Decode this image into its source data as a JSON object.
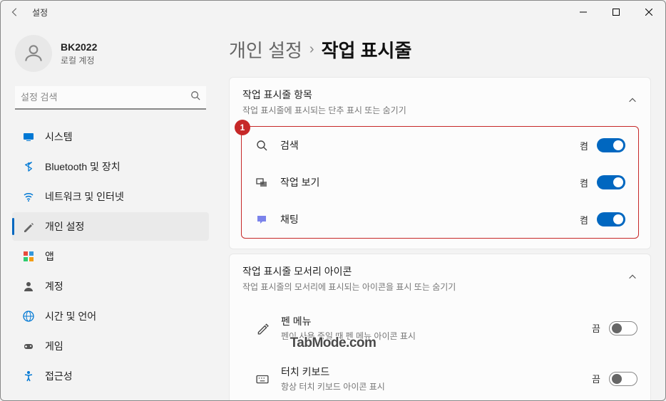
{
  "titlebar": {
    "app_title": "설정"
  },
  "profile": {
    "name": "BK2022",
    "sub": "로컬 계정"
  },
  "search": {
    "placeholder": "설정 검색"
  },
  "nav": {
    "items": [
      {
        "label": "시스템",
        "icon_color": "#0078d4"
      },
      {
        "label": "Bluetooth 및 장치",
        "icon_color": "#0078d4"
      },
      {
        "label": "네트워크 및 인터넷",
        "icon_color": "#0078d4"
      },
      {
        "label": "개인 설정",
        "icon_color": "#777"
      },
      {
        "label": "앱",
        "icon_color": "#e67e22"
      },
      {
        "label": "계정",
        "icon_color": "#555"
      },
      {
        "label": "시간 및 언어",
        "icon_color": "#0078d4"
      },
      {
        "label": "게임",
        "icon_color": "#555"
      },
      {
        "label": "접근성",
        "icon_color": "#0078d4"
      }
    ]
  },
  "breadcrumb": {
    "parent": "개인 설정",
    "current": "작업 표시줄"
  },
  "section1": {
    "title": "작업 표시줄 항목",
    "sub": "작업 표시줄에 표시되는 단추 표시 또는 숨기기",
    "badge": "1",
    "rows": [
      {
        "label": "검색",
        "state_text": "켬",
        "on": true
      },
      {
        "label": "작업 보기",
        "state_text": "켬",
        "on": true
      },
      {
        "label": "채팅",
        "state_text": "켬",
        "on": true
      }
    ]
  },
  "section2": {
    "title": "작업 표시줄 모서리 아이콘",
    "sub": "작업 표시줄의 모서리에 표시되는 아이콘을 표시 또는 숨기기",
    "rows": [
      {
        "label": "펜 메뉴",
        "desc": "펜이 사용 중일 때 펜 메뉴 아이콘 표시",
        "state_text": "끔",
        "on": false
      },
      {
        "label": "터치 키보드",
        "desc": "항상 터치 키보드 아이콘 표시",
        "state_text": "끔",
        "on": false
      }
    ]
  },
  "watermark": "TabMode.com"
}
